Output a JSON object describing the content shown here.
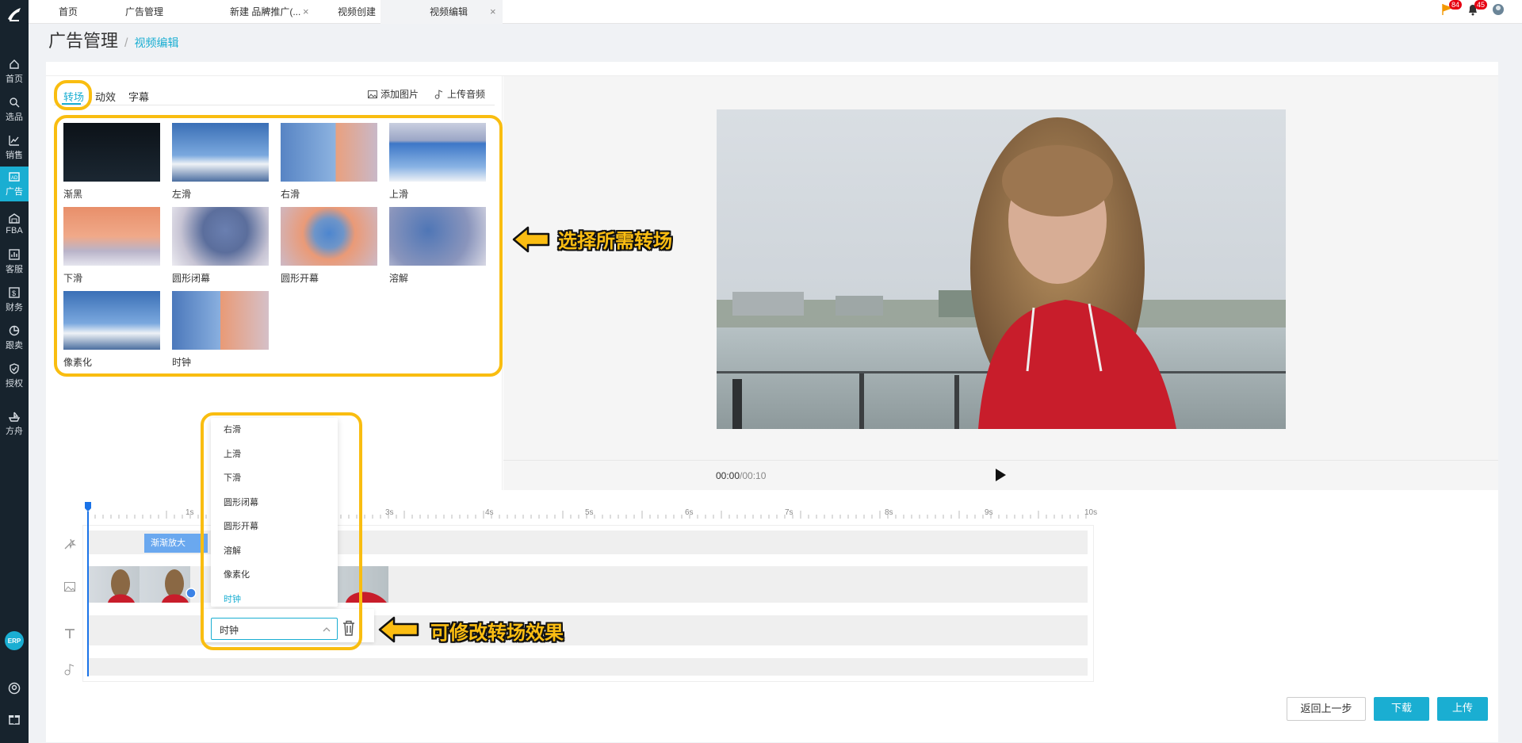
{
  "sidebar": {
    "items": [
      {
        "label": "首页",
        "icon": "home-icon"
      },
      {
        "label": "选品",
        "icon": "search-icon"
      },
      {
        "label": "销售",
        "icon": "chart-icon"
      },
      {
        "label": "广告",
        "icon": "ad-icon"
      },
      {
        "label": "FBA",
        "icon": "warehouse-icon"
      },
      {
        "label": "客服",
        "icon": "stats-icon"
      },
      {
        "label": "财务",
        "icon": "dollar-icon"
      },
      {
        "label": "跟卖",
        "icon": "pie-icon"
      },
      {
        "label": "授权",
        "icon": "shield-icon"
      },
      {
        "label": "方舟",
        "icon": "ark-icon"
      }
    ],
    "erp_label": "ERP",
    "active": "广告"
  },
  "tabs": [
    {
      "label": "首页",
      "closable": false
    },
    {
      "label": "广告管理",
      "closable": true
    },
    {
      "label": "新建 品牌推广(...",
      "closable": true
    },
    {
      "label": "视频创建",
      "closable": true
    },
    {
      "label": "视频编辑",
      "closable": true
    }
  ],
  "header": {
    "flag_badge": "84",
    "bell_badge": "45"
  },
  "breadcrumb": {
    "title": "广告管理",
    "separator": "/",
    "current": "视频编辑"
  },
  "panel": {
    "tabs": [
      "转场",
      "动效",
      "字幕"
    ],
    "active_tab": "转场",
    "add_image": "添加图片",
    "upload_audio": "上传音频",
    "transitions": [
      "渐黑",
      "左滑",
      "右滑",
      "上滑",
      "下滑",
      "圆形闭幕",
      "圆形开幕",
      "溶解",
      "像素化",
      "时钟"
    ]
  },
  "player": {
    "current_time": "00:00",
    "total_time": "/00:10"
  },
  "timeline": {
    "ticks": [
      "1s",
      "3s",
      "4s",
      "5s",
      "6s",
      "7s",
      "8s",
      "9s",
      "10s"
    ],
    "effect_chip": "渐渐放大"
  },
  "dropdown": {
    "options": [
      "右滑",
      "上滑",
      "下滑",
      "圆形闭幕",
      "圆形开幕",
      "溶解",
      "像素化",
      "时钟"
    ],
    "selected": "时钟"
  },
  "annotations": {
    "select_transition": "选择所需转场",
    "modify_transition": "可修改转场效果"
  },
  "buttons": {
    "back": "返回上一步",
    "download": "下载",
    "upload": "上传"
  },
  "colors": {
    "accent": "#1aaed2",
    "sidebar": "#17232d",
    "highlight": "#f9bd10"
  }
}
